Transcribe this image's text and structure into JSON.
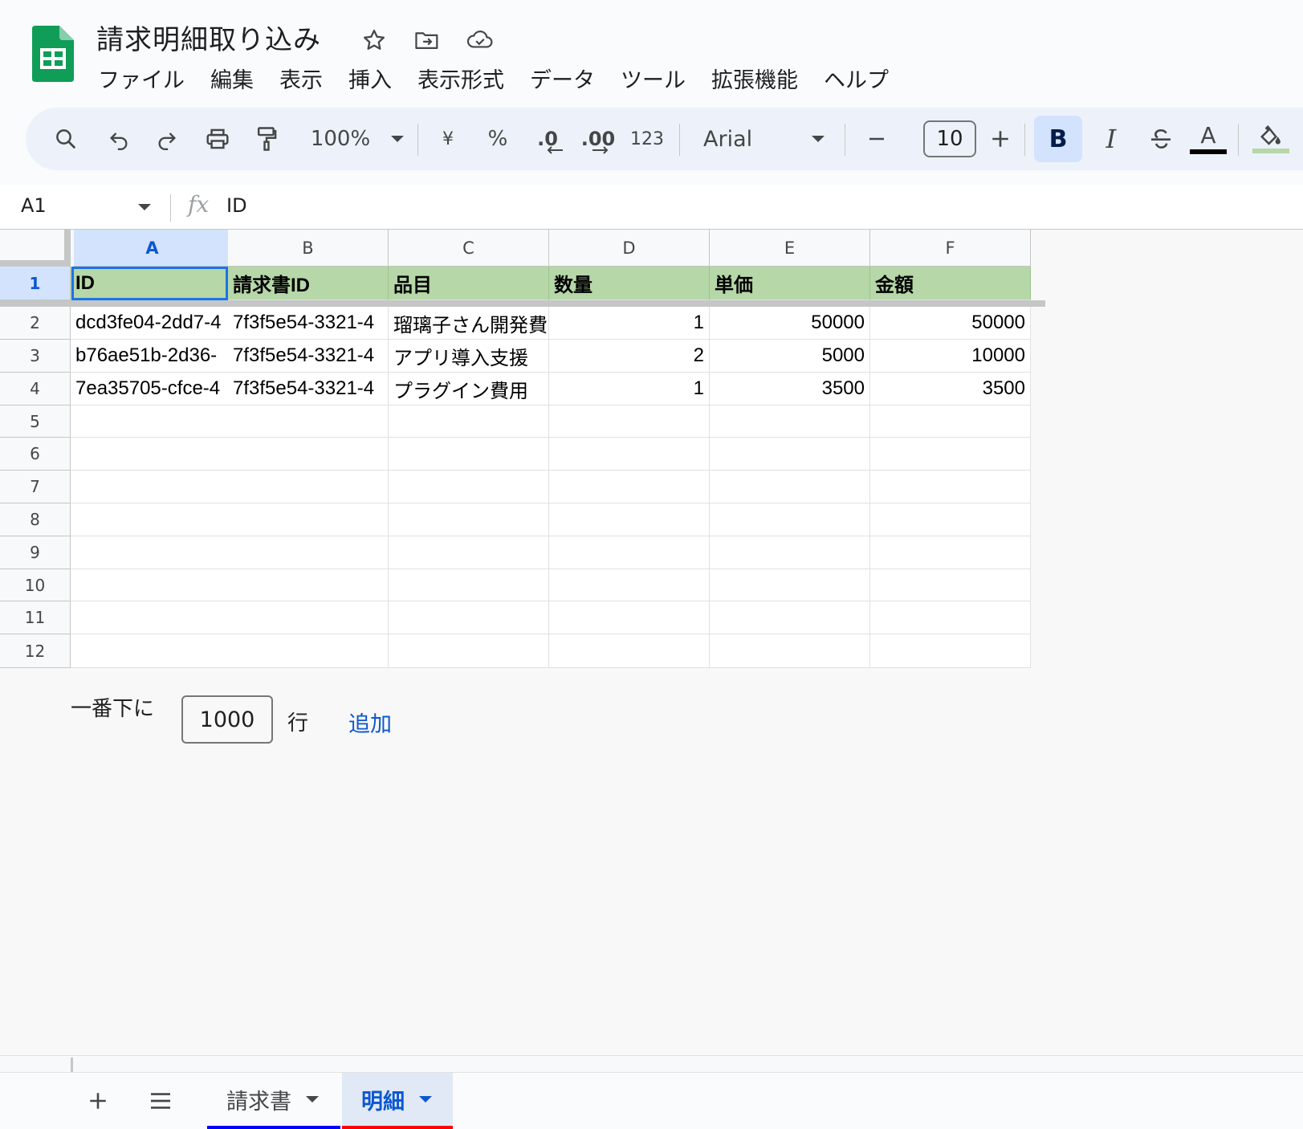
{
  "doc": {
    "title": "請求明細取り込み"
  },
  "menu": [
    "ファイル",
    "編集",
    "表示",
    "挿入",
    "表示形式",
    "データ",
    "ツール",
    "拡張機能",
    "ヘルプ"
  ],
  "toolbar": {
    "zoom": "100%",
    "currency": "¥",
    "percent": "%",
    "dec_decrease": ".0",
    "dec_increase": ".00",
    "number_format": "123",
    "font": "Arial",
    "font_size": "10",
    "bold": "B",
    "italic": "I",
    "text_color": "A",
    "text_color_value": "#000000",
    "fill_color_value": "#b6d7a8"
  },
  "formula_bar": {
    "name_box": "A1",
    "fx": "fx",
    "value": "ID"
  },
  "columns": [
    "A",
    "B",
    "C",
    "D",
    "E",
    "F"
  ],
  "row_numbers": [
    "1",
    "2",
    "3",
    "4",
    "5",
    "6",
    "7",
    "8",
    "9",
    "10",
    "11",
    "12"
  ],
  "header_row": [
    "ID",
    "請求書ID",
    "品目",
    "数量",
    "単価",
    "金額"
  ],
  "rows": [
    [
      "dcd3fe04-2dd7-4",
      "7f3f5e54-3321-4",
      "瑠璃子さん開発費",
      "1",
      "50000",
      "50000"
    ],
    [
      "b76ae51b-2d36-",
      "7f3f5e54-3321-4",
      "アプリ導入支援",
      "2",
      "5000",
      "10000"
    ],
    [
      "7ea35705-cfce-4",
      "7f3f5e54-3321-4",
      "プラグイン費用",
      "1",
      "3500",
      "3500"
    ]
  ],
  "add_rows": {
    "prefix": "一番下に",
    "count": "1000",
    "unit": "行",
    "button": "追加"
  },
  "sheets": [
    {
      "label": "請求書",
      "active": false,
      "color": "#0000ff"
    },
    {
      "label": "明細",
      "active": true,
      "color": "#ff0000"
    }
  ],
  "colors": {
    "accent": "#0b57d0",
    "header_fill": "#b6d7a8",
    "selection": "#d3e3fd"
  }
}
